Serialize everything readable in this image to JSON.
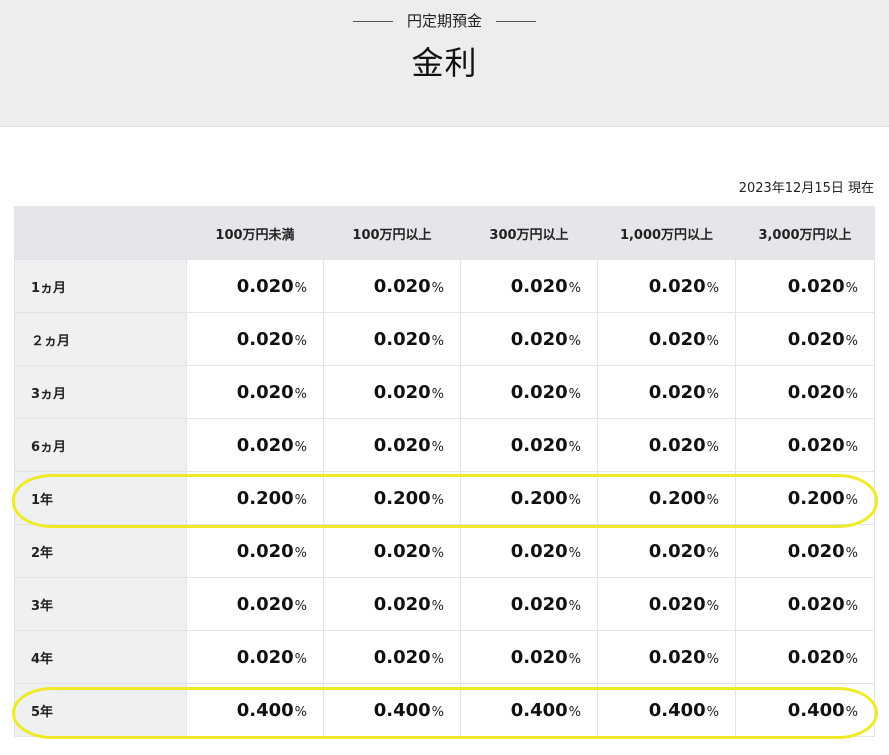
{
  "header": {
    "subtitle": "円定期預金",
    "title": "金利"
  },
  "as_of": "2023年12月15日 現在",
  "table": {
    "columns": [
      "100万円未満",
      "100万円以上",
      "300万円以上",
      "1,000万円以上",
      "3,000万円以上"
    ],
    "rows": [
      {
        "term": "1ヵ月",
        "rates": [
          "0.020",
          "0.020",
          "0.020",
          "0.020",
          "0.020"
        ]
      },
      {
        "term": "２ヵ月",
        "rates": [
          "0.020",
          "0.020",
          "0.020",
          "0.020",
          "0.020"
        ]
      },
      {
        "term": "3ヵ月",
        "rates": [
          "0.020",
          "0.020",
          "0.020",
          "0.020",
          "0.020"
        ]
      },
      {
        "term": "6ヵ月",
        "rates": [
          "0.020",
          "0.020",
          "0.020",
          "0.020",
          "0.020"
        ]
      },
      {
        "term": "1年",
        "rates": [
          "0.200",
          "0.200",
          "0.200",
          "0.200",
          "0.200"
        ]
      },
      {
        "term": "2年",
        "rates": [
          "0.020",
          "0.020",
          "0.020",
          "0.020",
          "0.020"
        ]
      },
      {
        "term": "3年",
        "rates": [
          "0.020",
          "0.020",
          "0.020",
          "0.020",
          "0.020"
        ]
      },
      {
        "term": "4年",
        "rates": [
          "0.020",
          "0.020",
          "0.020",
          "0.020",
          "0.020"
        ]
      },
      {
        "term": "5年",
        "rates": [
          "0.400",
          "0.400",
          "0.400",
          "0.400",
          "0.400"
        ]
      }
    ],
    "unit": "%"
  },
  "highlight": {
    "color": "#f0ea26",
    "rows": [
      "1年",
      "5年"
    ]
  }
}
